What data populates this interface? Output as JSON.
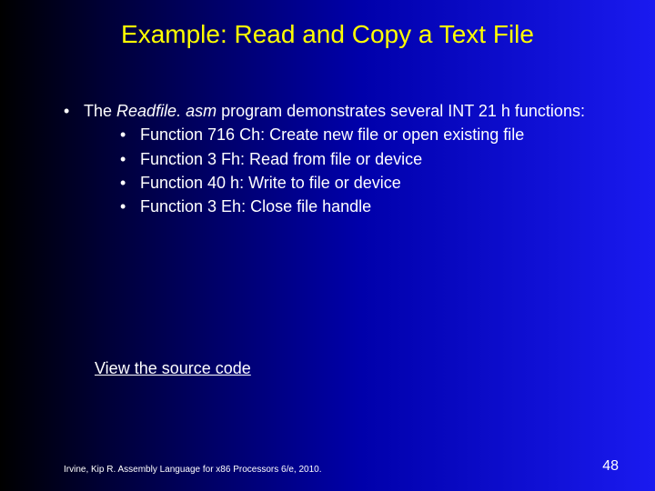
{
  "title": "Example: Read and Copy a Text File",
  "intro_prefix": "The ",
  "intro_italic": "Readfile. asm",
  "intro_suffix": " program demonstrates several INT 21 h functions:",
  "subs": {
    "a": "Function 716 Ch: Create new file or open existing file",
    "b": "Function 3 Fh: Read from file or device",
    "c": "Function 40 h: Write to file or device",
    "d": "Function 3 Eh: Close file handle"
  },
  "link": "View the source code",
  "footer": "Irvine, Kip R. Assembly Language for x86 Processors 6/e, 2010.",
  "pagenum": "48"
}
